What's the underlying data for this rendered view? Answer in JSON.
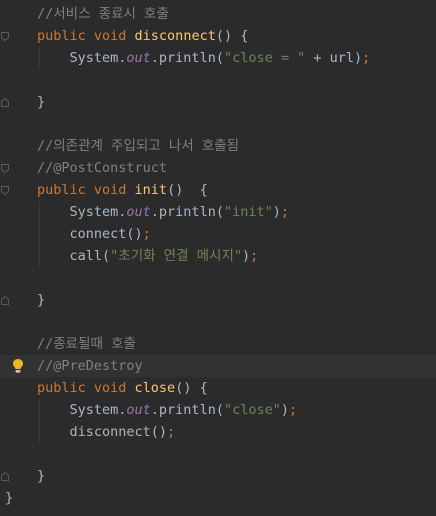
{
  "editor": {
    "lines": [
      {
        "tokens": [
          [
            "c",
            "//서비스 종료시 호출"
          ]
        ]
      },
      {
        "tokens": [
          [
            "k",
            "public void "
          ],
          [
            "f",
            "disconnect"
          ],
          [
            "p",
            "() {"
          ]
        ],
        "fold": "top"
      },
      {
        "tokens": [
          [
            "p",
            "    System."
          ],
          [
            "st",
            "out"
          ],
          [
            "p",
            ".println("
          ],
          [
            "s",
            "\"close = \""
          ],
          [
            "p",
            " + url"
          ],
          [
            "k",
            ";"
          ],
          [
            "p",
            ")"
          ]
        ],
        "order_fix": true
      },
      {
        "tokens": []
      },
      {
        "tokens": [
          [
            "p",
            "}"
          ]
        ],
        "fold": "bottom"
      },
      {
        "tokens": []
      },
      {
        "tokens": [
          [
            "c",
            "//의존관계 주입되고 나서 호출됨"
          ]
        ]
      },
      {
        "tokens": [
          [
            "c",
            "//@PostConstruct"
          ]
        ],
        "fold": "top"
      },
      {
        "tokens": [
          [
            "k",
            "public void "
          ],
          [
            "f",
            "init"
          ],
          [
            "p",
            "()  {"
          ]
        ],
        "fold": "top"
      },
      {
        "tokens": [
          [
            "p",
            "    System."
          ],
          [
            "st",
            "out"
          ],
          [
            "p",
            ".println("
          ],
          [
            "s",
            "\"init\""
          ],
          [
            "p",
            ")"
          ],
          [
            "k",
            ";"
          ]
        ]
      },
      {
        "tokens": [
          [
            "p",
            "    connect()"
          ],
          [
            "k",
            ";"
          ]
        ]
      },
      {
        "tokens": [
          [
            "p",
            "    call("
          ],
          [
            "s",
            "\"초기화 연결 메시지\""
          ],
          [
            "p",
            ")"
          ],
          [
            "k",
            ";"
          ]
        ]
      },
      {
        "tokens": []
      },
      {
        "tokens": [
          [
            "p",
            "}"
          ]
        ],
        "fold": "bottom"
      },
      {
        "tokens": []
      },
      {
        "tokens": [
          [
            "c",
            "//종료될때 호출"
          ]
        ]
      },
      {
        "tokens": [
          [
            "c",
            "//@PreDestroy"
          ]
        ],
        "current": true,
        "bulb": true
      },
      {
        "tokens": [
          [
            "k",
            "public void "
          ],
          [
            "f",
            "close"
          ],
          [
            "p",
            "() {"
          ]
        ]
      },
      {
        "tokens": [
          [
            "p",
            "    System."
          ],
          [
            "st",
            "out"
          ],
          [
            "p",
            ".println("
          ],
          [
            "s",
            "\"close\""
          ],
          [
            "p",
            ")"
          ],
          [
            "k",
            ";"
          ]
        ]
      },
      {
        "tokens": [
          [
            "p",
            "    disconnect()"
          ],
          [
            "k",
            ";"
          ]
        ]
      },
      {
        "tokens": []
      },
      {
        "tokens": [
          [
            "p",
            "}"
          ]
        ],
        "fold": "bottom"
      },
      {
        "tokens": [
          [
            "p",
            "}"
          ]
        ],
        "outer": true
      }
    ]
  },
  "colors": {
    "background": "#2b2b2b",
    "current_line": "#323232",
    "comment": "#808080",
    "keyword": "#cc7832",
    "method": "#ffc66d",
    "string": "#6a8759",
    "static_field": "#9876aa",
    "plain": "#a9b7c6",
    "bulb": "#f0b429"
  },
  "icons": {
    "fold_marker": "fold-marker-icon",
    "intention_bulb": "lightbulb-icon"
  }
}
